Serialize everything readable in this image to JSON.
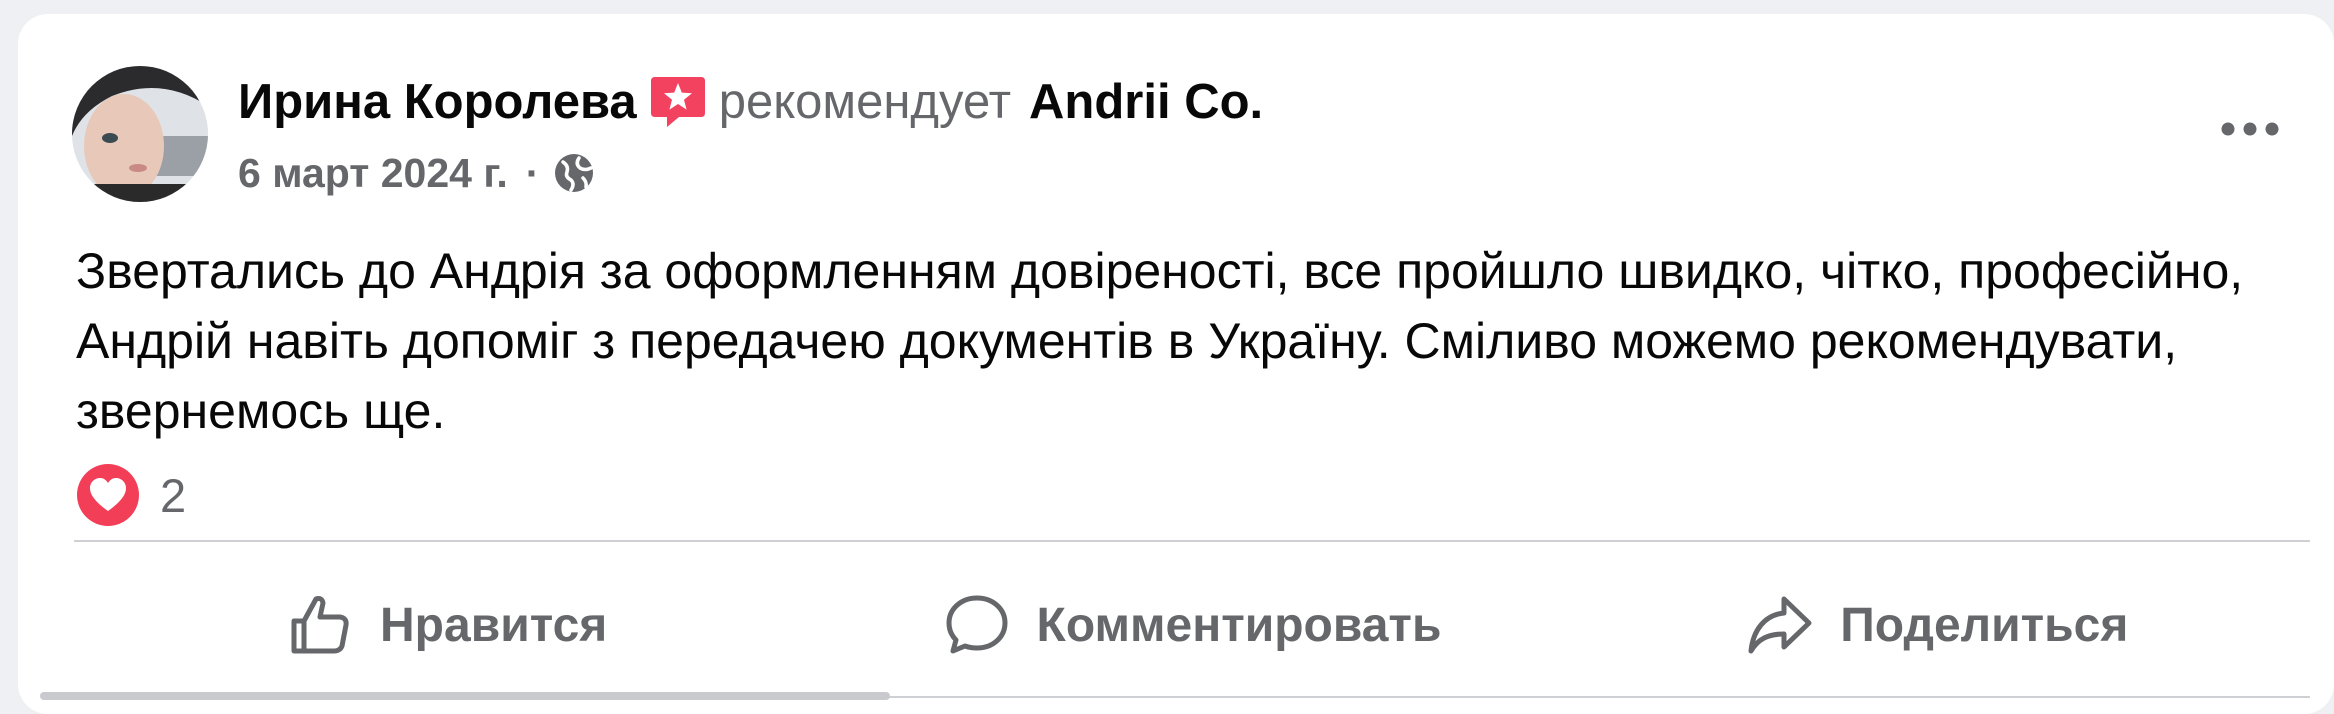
{
  "post": {
    "author": "Ирина Королева",
    "action_text": "рекомендует",
    "page_name": "Andrii Co.",
    "date": "6 март 2024 г.",
    "separator": "·",
    "privacy_icon": "globe-icon",
    "body": "Звертались до Андрія за оформленням довіреності, все пройшло швидко, чітко, професійно, Андрій навіть допоміг з передачею документів в Україну. Сміливо можемо рекомендувати, звернемось ще.",
    "reaction_icon": "heart-icon",
    "reaction_count": "2"
  },
  "actions": {
    "like_label": "Нравится",
    "comment_label": "Комментировать",
    "share_label": "Поделиться"
  },
  "colors": {
    "recommend_badge": "#f3425f",
    "heart_badge": "#f33e58",
    "secondary_text": "#65676b",
    "primary_text": "#080809"
  }
}
